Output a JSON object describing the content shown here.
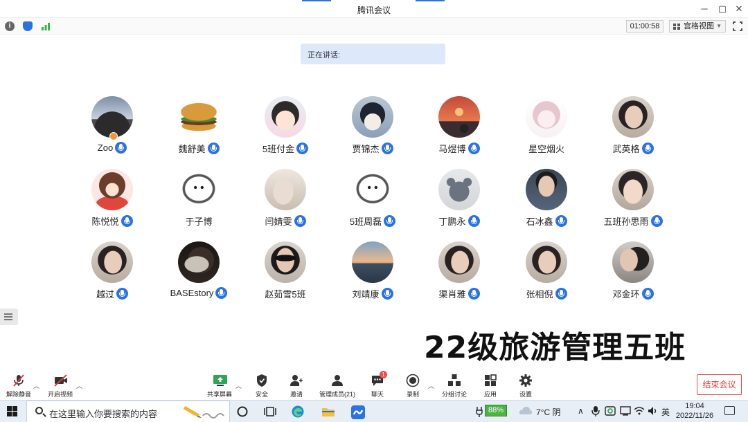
{
  "window": {
    "title": "腾讯会议"
  },
  "toolbar": {
    "timer": "01:00:58",
    "view_mode": "宫格视图"
  },
  "speaking": {
    "label": "正在讲话:"
  },
  "participants": [
    {
      "name": "Zoo",
      "mic": true,
      "avatar": "landscape-photo-avatar",
      "host": true
    },
    {
      "name": "魏舒美",
      "mic": true,
      "avatar": "burger-avatar"
    },
    {
      "name": "5班付金",
      "mic": true,
      "avatar": "anime-cat-girl-avatar"
    },
    {
      "name": "贾锦杰",
      "mic": true,
      "avatar": "anime-boy-avatar"
    },
    {
      "name": "马煜博",
      "mic": true,
      "avatar": "sunset-avatar"
    },
    {
      "name": "星空烟火",
      "mic": false,
      "avatar": "sketch-girl-avatar"
    },
    {
      "name": "武英格",
      "mic": true,
      "avatar": "girl-photo-avatar"
    },
    {
      "name": "陈悦悦",
      "mic": true,
      "avatar": "cartoon-girl-avatar"
    },
    {
      "name": "于子博",
      "mic": false,
      "avatar": "pochacco-avatar"
    },
    {
      "name": "闫婧雯",
      "mic": true,
      "avatar": "beach-photo-avatar"
    },
    {
      "name": "5班周磊",
      "mic": true,
      "avatar": "pochacco-avatar"
    },
    {
      "name": "丁鹏永",
      "mic": true,
      "avatar": "bear-avatar"
    },
    {
      "name": "石冰鑫",
      "mic": true,
      "avatar": "boy-photo-avatar"
    },
    {
      "name": "五班孙思雨",
      "mic": true,
      "avatar": "anime-man-avatar"
    },
    {
      "name": "越过",
      "mic": true,
      "avatar": "girl-photo-avatar"
    },
    {
      "name": "BASEstory",
      "mic": true,
      "avatar": "dark-photo-avatar"
    },
    {
      "name": "赵茹雪5班",
      "mic": false,
      "avatar": "girl-sunglasses-avatar"
    },
    {
      "name": "刘靖康",
      "mic": true,
      "avatar": "sunset-sea-avatar"
    },
    {
      "name": "渠肖雅",
      "mic": true,
      "avatar": "girl-photo-avatar"
    },
    {
      "name": "张相倪",
      "mic": true,
      "avatar": "girl-photo-avatar"
    },
    {
      "name": "邓金环",
      "mic": true,
      "avatar": "couple-photo-avatar"
    }
  ],
  "overlay_text": "22级旅游管理五班",
  "meeting_controls": {
    "unmute": "解除静音",
    "start_video": "开启视频",
    "share_screen": "共享屏幕",
    "security": "安全",
    "invite": "邀请",
    "manage_members": "管理成员(21)",
    "chat": "聊天",
    "chat_badge": "1",
    "record": "录制",
    "breakout": "分组讨论",
    "apps": "应用",
    "settings": "设置",
    "end_meeting": "结束会议"
  },
  "taskbar": {
    "search_placeholder": "在这里输入你要搜索的内容",
    "battery": "88%",
    "weather": "7°C 阴",
    "ime": "英",
    "time": "19:04",
    "date": "2022/11/26"
  },
  "colors": {
    "accent": "#2b72e6",
    "end_red": "#e03c3c",
    "battery_green": "#4bb543"
  }
}
